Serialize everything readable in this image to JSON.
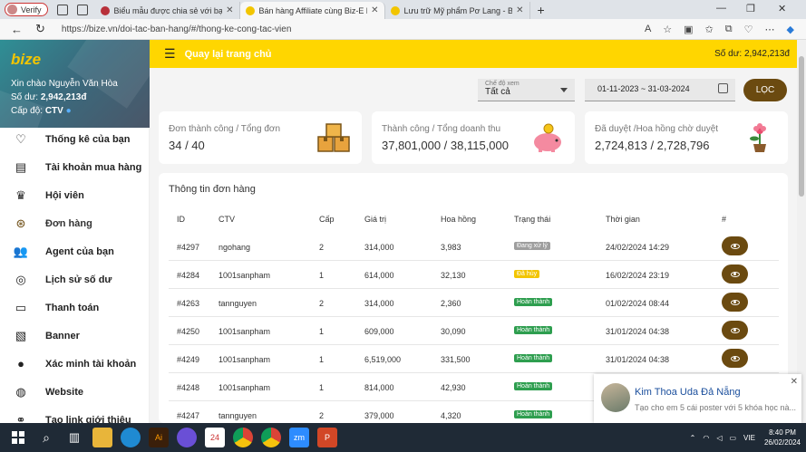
{
  "browser": {
    "verify_label": "Verify",
    "tabs": [
      {
        "label": "Biểu mẫu được chia sẻ với bạn: Tư vấn thiết kế",
        "color": "#b8303a",
        "active": false
      },
      {
        "label": "Bán hàng Affiliate cùng Biz-E kho",
        "color": "#f2c500",
        "active": true
      },
      {
        "label": "Lưu trữ Mỹ phẩm Pơ Lang - Biz-E",
        "color": "#f2c500",
        "active": false
      }
    ],
    "new_tab": "+",
    "url": "https://bize.vn/doi-tac-ban-hang/#/thong-ke-cong-tac-vien"
  },
  "sidebar": {
    "logo": "bize",
    "greeting": "Xin chào Nguyễn Văn Hòa",
    "balance_label": "Số dư:",
    "balance_value": "2,942,213đ",
    "level_label": "Cấp độ:",
    "level_value": "CTV",
    "items": [
      {
        "label": "Thống kê của bạn",
        "icon": "heart-icon"
      },
      {
        "label": "Tài khoản mua hàng",
        "icon": "dollar-icon"
      },
      {
        "label": "Hội viên",
        "icon": "crown-icon"
      },
      {
        "label": "Đơn hàng",
        "icon": "box-icon"
      },
      {
        "label": "Agent của bạn",
        "icon": "users-icon"
      },
      {
        "label": "Lịch sử số dư",
        "icon": "fingerprint-icon"
      },
      {
        "label": "Thanh toán",
        "icon": "card-icon"
      },
      {
        "label": "Banner",
        "icon": "image-icon"
      },
      {
        "label": "Xác minh tài khoản",
        "icon": "user-icon"
      },
      {
        "label": "Website",
        "icon": "globe-icon"
      },
      {
        "label": "Tạo link giới thiệu",
        "icon": "link-icon"
      }
    ]
  },
  "topbar": {
    "back_label": "Quay lại trang chủ",
    "balance": "Số dư: 2,942,213đ"
  },
  "filters": {
    "mode_label": "Chế độ xem",
    "mode_value": "Tất cả",
    "date_range": "01-11-2023 ~ 31-03-2024",
    "filter_button": "LỌC"
  },
  "stats": [
    {
      "title": "Đơn thành công / Tổng đơn",
      "value": "34 / 40",
      "icon": "boxes-icon"
    },
    {
      "title": "Thành công / Tổng doanh thu",
      "value": "37,801,000 / 38,115,000",
      "icon": "piggy-bank-icon"
    },
    {
      "title": "Đã duyệt /Hoa hồng chờ duyệt",
      "value": "2,724,813 / 2,728,796",
      "icon": "flower-pot-icon"
    }
  ],
  "orders": {
    "title": "Thông tin đơn hàng",
    "columns": [
      "ID",
      "CTV",
      "Cấp",
      "Giá trị",
      "Hoa hồng",
      "Trạng thái",
      "Thời gian",
      "#"
    ],
    "rows": [
      {
        "id": "#4297",
        "ctv": "ngohang",
        "cap": "2",
        "value": "314,000",
        "commission": "3,983",
        "status": "Đang xử lý",
        "status_color": "#9e9e9e",
        "time": "24/02/2024 14:29"
      },
      {
        "id": "#4284",
        "ctv": "1001sanpham",
        "cap": "1",
        "value": "614,000",
        "commission": "32,130",
        "status": "Đã hủy",
        "status_color": "#f2c500",
        "time": "16/02/2024 23:19"
      },
      {
        "id": "#4263",
        "ctv": "tannguyen",
        "cap": "2",
        "value": "314,000",
        "commission": "2,360",
        "status": "Hoàn thành",
        "status_color": "#2e9e4f",
        "time": "01/02/2024 08:44"
      },
      {
        "id": "#4250",
        "ctv": "1001sanpham",
        "cap": "1",
        "value": "609,000",
        "commission": "30,090",
        "status": "Hoàn thành",
        "status_color": "#2e9e4f",
        "time": "31/01/2024 04:38"
      },
      {
        "id": "#4249",
        "ctv": "1001sanpham",
        "cap": "1",
        "value": "6,519,000",
        "commission": "331,500",
        "status": "Hoàn thành",
        "status_color": "#2e9e4f",
        "time": "31/01/2024 04:38"
      },
      {
        "id": "#4248",
        "ctv": "1001sanpham",
        "cap": "1",
        "value": "814,000",
        "commission": "42,930",
        "status": "Hoàn thành",
        "status_color": "#2e9e4f",
        "time": ""
      },
      {
        "id": "#4247",
        "ctv": "tannguyen",
        "cap": "2",
        "value": "379,000",
        "commission": "4,320",
        "status": "Hoàn thành",
        "status_color": "#2e9e4f",
        "time": ""
      }
    ]
  },
  "notification": {
    "name": "Kim Thoa Uda Đả Nẵng",
    "message": "Tạo cho em 5 cái poster với 5 khóa học nà..."
  },
  "taskbar": {
    "lang": "VIE",
    "time": "8:40 PM",
    "date": "26/02/2024"
  },
  "colors": {
    "accent": "#ffd600",
    "brown": "#6b4a10",
    "success": "#2e9e4f"
  }
}
